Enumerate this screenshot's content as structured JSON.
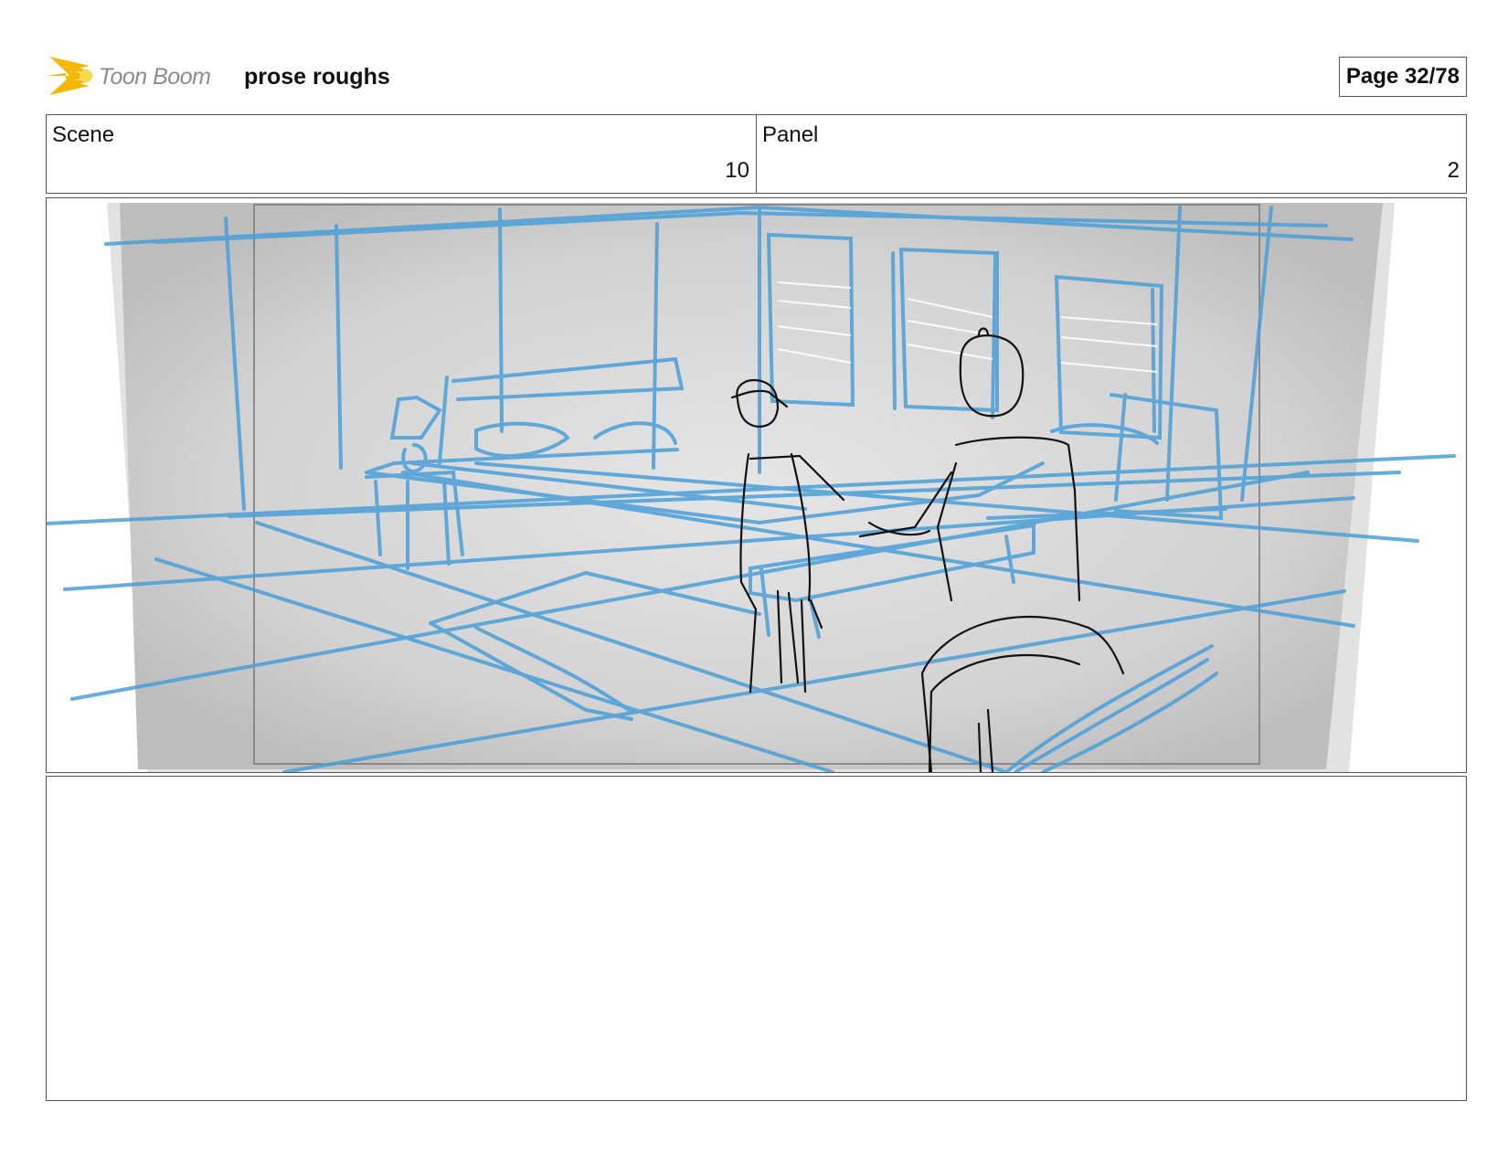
{
  "header": {
    "logo_text": "Toon Boom",
    "project_title": "prose roughs",
    "page_label": "Page 32/78"
  },
  "meta": {
    "scene_label": "Scene",
    "scene_value": "10",
    "panel_label": "Panel",
    "panel_value": "2"
  },
  "colors": {
    "sketch_blue": "#4a9fd8",
    "sketch_black": "#111111",
    "background_gray": "#d4d4d4",
    "logo_yellow": "#f5b800"
  },
  "notes": {
    "text": ""
  }
}
